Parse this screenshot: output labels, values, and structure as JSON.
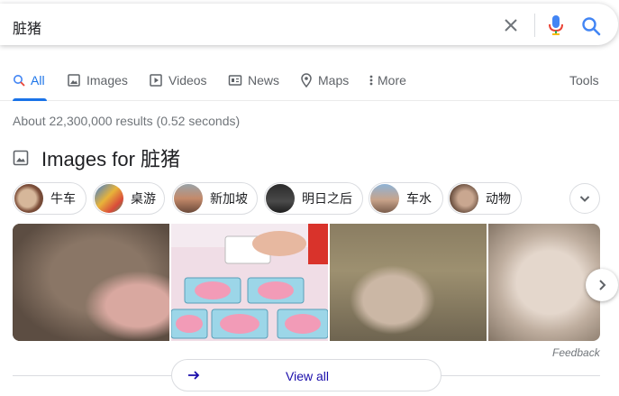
{
  "search": {
    "query": "脏猪"
  },
  "tabs": [
    {
      "label": "All",
      "icon": "search-icon"
    },
    {
      "label": "Images",
      "icon": "image-icon"
    },
    {
      "label": "Videos",
      "icon": "play-icon"
    },
    {
      "label": "News",
      "icon": "news-icon"
    },
    {
      "label": "Maps",
      "icon": "map-pin-icon"
    },
    {
      "label": "More",
      "icon": "more-vert-icon"
    }
  ],
  "tools_label": "Tools",
  "result_stats": "About 22,300,000 results (0.52 seconds)",
  "images_section": {
    "title": "Images for 脏猪",
    "chips": [
      {
        "label": "牛车"
      },
      {
        "label": "桌游"
      },
      {
        "label": "新加坡"
      },
      {
        "label": "明日之后"
      },
      {
        "label": "车水"
      },
      {
        "label": "动物"
      }
    ],
    "feedback_label": "Feedback",
    "view_all_label": "View all"
  },
  "colors": {
    "accent": "#1a73e8",
    "link": "#1a0dab",
    "muted": "#70757a"
  }
}
